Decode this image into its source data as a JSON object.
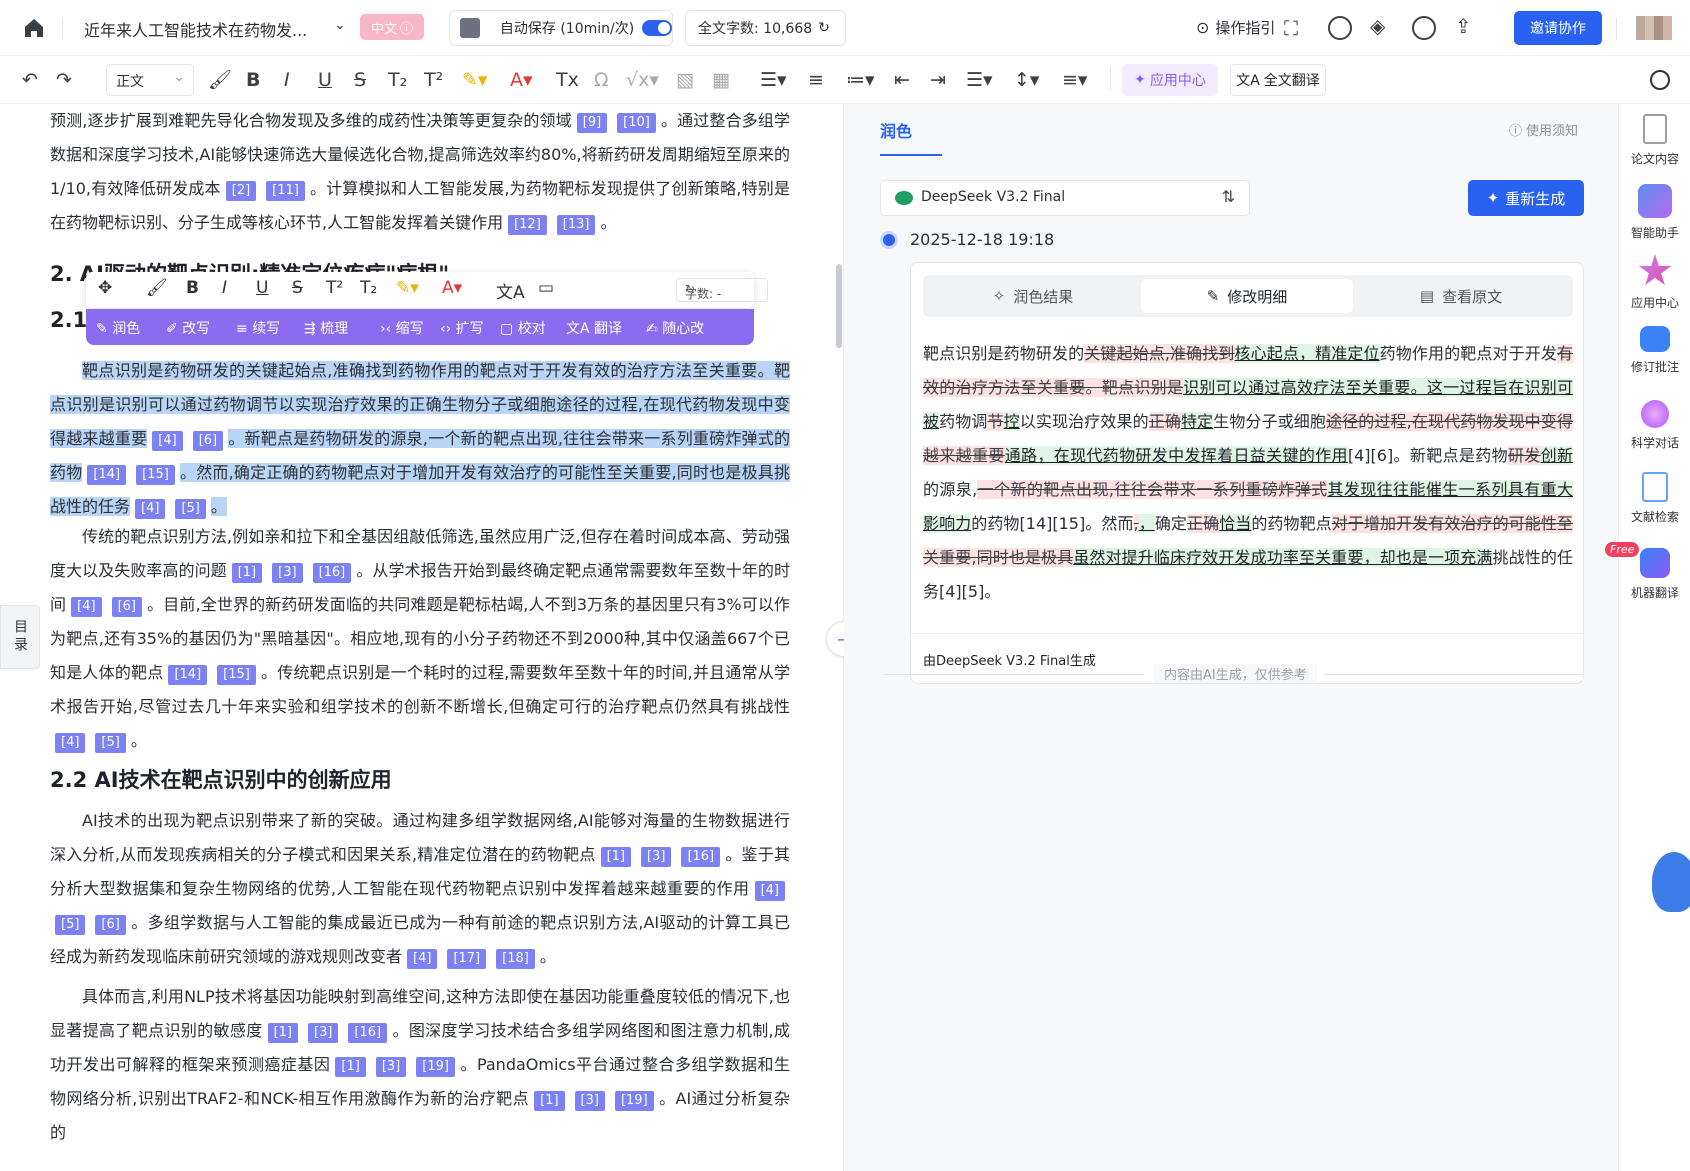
{
  "topbar": {
    "doc_title": "近年来人工智能技术在药物发...",
    "lang_badge": "中文",
    "autosave_label": "自动保存 (10min/次)",
    "word_count_label": "全文字数: 10,668",
    "guide_label": "操作指引",
    "invite_label": "邀请协作"
  },
  "toolbar": {
    "style_value": "正文",
    "app_center_label": "应用中心",
    "full_translate_label": "全文翻译"
  },
  "float_toolbar": {
    "count_label": "字数: -",
    "actions": [
      "润色",
      "改写",
      "续写",
      "梳理",
      "缩写",
      "扩写",
      "校对",
      "翻译",
      "随心改"
    ]
  },
  "toc_label": "目录",
  "editor": {
    "p0": {
      "text": "预测,逐步扩展到难靶先导化合物发现及多维的成药性决策等更复杂的领域",
      "refs1": [
        "[9]",
        "[10]"
      ],
      "t2": "。通过整合多组学数据和深度学习技术,AI能够快速筛选大量候选化合物,提高筛选效率约80%,将新药研发周期缩短至原来的1/10,有效降低研发成本",
      "refs2": [
        "[2]",
        "[11]"
      ],
      "t3": "。计算模拟和人工智能发展,为药物靶标发现提供了创新策略,特别是在药物靶标识别、分子生成等核心环节,人工智能发挥着关键作用",
      "refs3": [
        "[12]",
        "[13]"
      ],
      "t4": "。"
    },
    "h2_section": "2. AI驱动的靶点识别:精准定位疾病\"病根\"",
    "h21_partial": "2.1",
    "p1": {
      "t1": "靶点识别是药物研发的关键起始点,准确找到药物作用的靶点对于开发有效的治疗方法至关重要。靶点识别是识别可以通过药物调节以实现治疗效果的正确生物分子或细胞途径的过程,在现代药物发现中变得越来越重要",
      "r1": [
        "[4]",
        "[6]"
      ],
      "t2": "。新靶点是药物研发的源泉,一个新的靶点出现,往往会带来一系列重磅炸弹式的药物",
      "r2": [
        "[14]",
        "[15]"
      ],
      "t3": "。然而,确定正确的药物靶点对于增加开发有效治疗的可能性至关重要,同时也是极具挑战性的任务",
      "r3": [
        "[4]",
        "[5]"
      ],
      "t4": "。"
    },
    "p2": {
      "t1": "传统的靶点识别方法,例如亲和拉下和全基因组敲低筛选,虽然应用广泛,但存在着时间成本高、劳动强度大以及失败率高的问题",
      "r1": [
        "[1]",
        "[3]",
        "[16]"
      ],
      "t2": "。从学术报告开始到最终确定靶点通常需要数年至数十年的时间",
      "r2": [
        "[4]",
        "[6]"
      ],
      "t3": "。目前,全世界的新药研发面临的共同难题是靶标枯竭,人不到3万条的基因里只有3%可以作为靶点,还有35%的基因仍为\"黑暗基因\"。相应地,现有的小分子药物还不到2000种,其中仅涵盖667个已知是人体的靶点",
      "r3": [
        "[14]",
        "[15]"
      ],
      "t4": "。传统靶点识别是一个耗时的过程,需要数年至数十年的时间,并且通常从学术报告开始,尽管过去几十年来实验和组学技术的创新不断增长,但确定可行的治疗靶点仍然具有挑战性",
      "r4": [
        "[4]",
        "[5]"
      ],
      "t5": "。"
    },
    "h2_2": "2.2 AI技术在靶点识别中的创新应用",
    "p3": {
      "t1": "AI技术的出现为靶点识别带来了新的突破。通过构建多组学数据网络,AI能够对海量的生物数据进行深入分析,从而发现疾病相关的分子模式和因果关系,精准定位潜在的药物靶点",
      "r1": [
        "[1]",
        "[3]",
        "[16]"
      ],
      "t2": "。鉴于其分析大型数据集和复杂生物网络的优势,人工智能在现代药物靶点识别中发挥着越来越重要的作用",
      "r2": [
        "[4]",
        "[5]",
        "[6]"
      ],
      "t3": "。多组学数据与人工智能的集成最近已成为一种有前途的靶点识别方法,AI驱动的计算工具已经成为新药发现临床前研究领域的游戏规则改变者",
      "r3": [
        "[4]",
        "[17]",
        "[18]"
      ],
      "t4": "。"
    },
    "p4": {
      "t1": "具体而言,利用NLP技术将基因功能映射到高维空间,这种方法即使在基因功能重叠度较低的情况下,也显著提高了靶点识别的敏感度",
      "r1": [
        "[1]",
        "[3]",
        "[16]"
      ],
      "t2": "。图深度学习技术结合多组学网络图和图注意力机制,成功开发出可解释的框架来预测癌症基因",
      "r2": [
        "[1]",
        "[3]",
        "[19]"
      ],
      "t3": "。PandaOmics平台通过整合多组学数据和生物网络分析,识别出TRAF2-和NCK-相互作用激酶作为新的治疗靶点",
      "r3": [
        "[1]",
        "[3]",
        "[19]"
      ],
      "t4": "。AI通过分析复杂的"
    }
  },
  "panel": {
    "tab_label": "润色",
    "notice": "使用须知",
    "model": "DeepSeek V3.2 Final",
    "regen_label": "重新生成",
    "timestamp": "2025-12-18 19:18",
    "tabs": [
      "润色结果",
      "修改明细",
      "查看原文"
    ],
    "footer": "由DeepSeek V3.2 Final生成",
    "ai_note": "内容由AI生成，仅供参考",
    "diff": [
      {
        "k": "n",
        "t": "靶点识别是药物研发的"
      },
      {
        "k": "d",
        "t": "关键起始点,准确找到"
      },
      {
        "k": "i",
        "t": "核心起点，精准定位"
      },
      {
        "k": "n",
        "t": "药物作用的靶点对于开发"
      },
      {
        "k": "d",
        "t": "有效的治疗方法至关重要。靶点识别是"
      },
      {
        "k": "i",
        "t": "识别可以通过高效疗法至关重要。这一过程旨在识别可被"
      },
      {
        "k": "n",
        "t": "药物调"
      },
      {
        "k": "d",
        "t": "节"
      },
      {
        "k": "i",
        "t": "控"
      },
      {
        "k": "n",
        "t": "以实现治疗效果的"
      },
      {
        "k": "d",
        "t": "正确"
      },
      {
        "k": "i",
        "t": "特定"
      },
      {
        "k": "n",
        "t": "生物分子或细胞"
      },
      {
        "k": "d",
        "t": "途径的过程,在现代药物发现中变得越来越重要"
      },
      {
        "k": "i",
        "t": "通路，在现代药物研发中发挥着日益关键的作用"
      },
      {
        "k": "n",
        "t": "[4][6]。新靶点是药物"
      },
      {
        "k": "d",
        "t": "研发"
      },
      {
        "k": "i",
        "t": "创新"
      },
      {
        "k": "n",
        "t": "的源泉,"
      },
      {
        "k": "d",
        "t": "一个新的靶点出现,往往会带来一系列重磅炸弹式"
      },
      {
        "k": "i",
        "t": "其发现往往能催生一系列具有重大影响力"
      },
      {
        "k": "n",
        "t": "的药物[14][15]。然而"
      },
      {
        "k": "d",
        "t": ","
      },
      {
        "k": "i",
        "t": "，"
      },
      {
        "k": "n",
        "t": "确定"
      },
      {
        "k": "d",
        "t": "正确"
      },
      {
        "k": "i",
        "t": "恰当"
      },
      {
        "k": "n",
        "t": "的药物靶点"
      },
      {
        "k": "d",
        "t": "对于增加开发有效治疗的可能性至关重要,同时也是极具"
      },
      {
        "k": "i",
        "t": "虽然对提升临床疗效开发成功率至关重要，却也是一项充满"
      },
      {
        "k": "n",
        "t": "挑战性的任务[4][5]。"
      }
    ]
  },
  "right_sidebar": {
    "items": [
      "论文内容",
      "智能助手",
      "应用中心",
      "修订批注",
      "科学对话",
      "文献检索",
      "机器翻译"
    ],
    "free_badge": "Free"
  },
  "colors": {
    "accent": "#2962f0",
    "ref_chip": "#7c81f4",
    "ai_purple": "#8b6cf0",
    "selection": "#b9d4f5"
  }
}
